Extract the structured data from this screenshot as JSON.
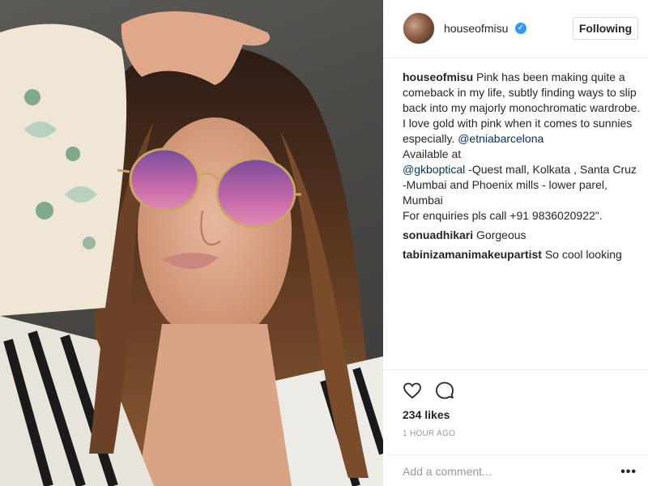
{
  "post": {
    "image_alt": "Woman with long brown hair wearing round pink-tinted sunglasses, hand raised to her head"
  },
  "header": {
    "username": "houseofmisu",
    "verified_symbol": "✓",
    "follow_label": "Following"
  },
  "caption": {
    "username": "houseofmisu",
    "text_1": " Pink has been making quite a comeback in my life, subtly finding ways to slip back into my majorly monochromatic wardrobe. I love gold with pink when it comes to sunnies especially. ",
    "mention_1": "@etniabarcelona",
    "text_2": "Available at",
    "mention_2": "@gkboptical",
    "text_3": " -Quest mall, Kolkata , Santa Cruz -Mumbai and Phoenix mills - lower parel, Mumbai",
    "text_4": "For enquiries pls call +91 9836020922\"."
  },
  "comments": [
    {
      "username": "sonuadhikari",
      "text": " Gorgeous"
    },
    {
      "username": "tabinizamanimakeupartist",
      "text": " So cool looking"
    }
  ],
  "actions": {
    "heart_icon": "heart-icon",
    "comment_icon": "comment-icon",
    "likes": "234 likes",
    "time": "1 HOUR AGO"
  },
  "add_comment": {
    "placeholder": "Add a comment...",
    "more_icon": "•••"
  },
  "colors": {
    "link": "#003569",
    "verified": "#3897f0",
    "muted": "#999999",
    "text": "#262626"
  }
}
